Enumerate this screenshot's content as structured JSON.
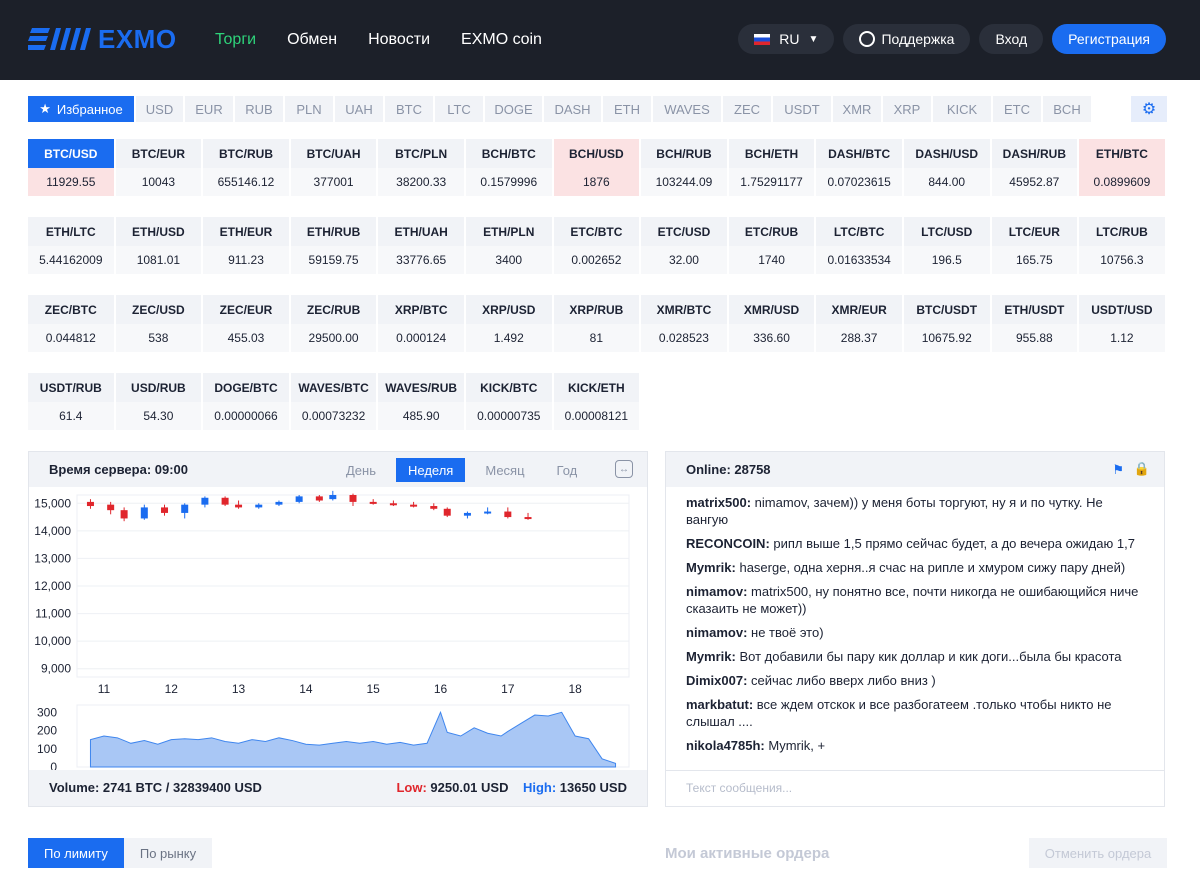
{
  "header": {
    "logo_text": "EXMO",
    "nav": [
      "Торги",
      "Обмен",
      "Новости",
      "EXMO coin"
    ],
    "lang": "RU",
    "support": "Поддержка",
    "login": "Вход",
    "register": "Регистрация"
  },
  "currency_tabs": [
    "Избранное",
    "USD",
    "EUR",
    "RUB",
    "PLN",
    "UAH",
    "BTC",
    "LTC",
    "DOGE",
    "DASH",
    "ETH",
    "WAVES",
    "ZEC",
    "USDT",
    "XMR",
    "XRP",
    "KICK",
    "ETC",
    "BCH"
  ],
  "pair_rows": [
    [
      {
        "pair": "BTC/USD",
        "price": "11929.55"
      },
      {
        "pair": "BTC/EUR",
        "price": "10043"
      },
      {
        "pair": "BTC/RUB",
        "price": "655146.12"
      },
      {
        "pair": "BTC/UAH",
        "price": "377001"
      },
      {
        "pair": "BTC/PLN",
        "price": "38200.33"
      },
      {
        "pair": "BCH/BTC",
        "price": "0.1579996"
      },
      {
        "pair": "BCH/USD",
        "price": "1876"
      },
      {
        "pair": "BCH/RUB",
        "price": "103244.09"
      },
      {
        "pair": "BCH/ETH",
        "price": "1.75291177"
      },
      {
        "pair": "DASH/BTC",
        "price": "0.07023615"
      },
      {
        "pair": "DASH/USD",
        "price": "844.00"
      },
      {
        "pair": "DASH/RUB",
        "price": "45952.87"
      },
      {
        "pair": "ETH/BTC",
        "price": "0.0899609"
      }
    ],
    [
      {
        "pair": "ETH/LTC",
        "price": "5.44162009"
      },
      {
        "pair": "ETH/USD",
        "price": "1081.01"
      },
      {
        "pair": "ETH/EUR",
        "price": "911.23"
      },
      {
        "pair": "ETH/RUB",
        "price": "59159.75"
      },
      {
        "pair": "ETH/UAH",
        "price": "33776.65"
      },
      {
        "pair": "ETH/PLN",
        "price": "3400"
      },
      {
        "pair": "ETC/BTC",
        "price": "0.002652"
      },
      {
        "pair": "ETC/USD",
        "price": "32.00"
      },
      {
        "pair": "ETC/RUB",
        "price": "1740"
      },
      {
        "pair": "LTC/BTC",
        "price": "0.01633534"
      },
      {
        "pair": "LTC/USD",
        "price": "196.5"
      },
      {
        "pair": "LTC/EUR",
        "price": "165.75"
      },
      {
        "pair": "LTC/RUB",
        "price": "10756.3"
      }
    ],
    [
      {
        "pair": "ZEC/BTC",
        "price": "0.044812"
      },
      {
        "pair": "ZEC/USD",
        "price": "538"
      },
      {
        "pair": "ZEC/EUR",
        "price": "455.03"
      },
      {
        "pair": "ZEC/RUB",
        "price": "29500.00"
      },
      {
        "pair": "XRP/BTC",
        "price": "0.000124"
      },
      {
        "pair": "XRP/USD",
        "price": "1.492"
      },
      {
        "pair": "XRP/RUB",
        "price": "81"
      },
      {
        "pair": "XMR/BTC",
        "price": "0.028523"
      },
      {
        "pair": "XMR/USD",
        "price": "336.60"
      },
      {
        "pair": "XMR/EUR",
        "price": "288.37"
      },
      {
        "pair": "BTC/USDT",
        "price": "10675.92"
      },
      {
        "pair": "ETH/USDT",
        "price": "955.88"
      },
      {
        "pair": "USDT/USD",
        "price": "1.12"
      }
    ],
    [
      {
        "pair": "USDT/RUB",
        "price": "61.4"
      },
      {
        "pair": "USD/RUB",
        "price": "54.30"
      },
      {
        "pair": "DOGE/BTC",
        "price": "0.00000066"
      },
      {
        "pair": "WAVES/BTC",
        "price": "0.00073232"
      },
      {
        "pair": "WAVES/RUB",
        "price": "485.90"
      },
      {
        "pair": "KICK/BTC",
        "price": "0.00000735"
      },
      {
        "pair": "KICK/ETH",
        "price": "0.00008121"
      }
    ]
  ],
  "chart": {
    "server_time": "Время сервера: 09:00",
    "periods": [
      "День",
      "Неделя",
      "Месяц",
      "Год"
    ],
    "active_period": "Неделя",
    "volume": "Volume: 2741 BTC / 32839400 USD",
    "low_label": "Low:",
    "low_value": "9250.01 USD",
    "high_label": "High:",
    "high_value": "13650 USD"
  },
  "chart_data": {
    "type": "candlestick",
    "yticks": [
      "15,000",
      "14,000",
      "13,000",
      "12,000",
      "11,000",
      "10,000",
      "9,000"
    ],
    "ylim": [
      8700,
      15300
    ],
    "xticks": [
      "11",
      "12",
      "13",
      "14",
      "15",
      "16",
      "17",
      "18"
    ],
    "x_tick_positions": [
      11,
      12,
      13,
      14,
      15,
      16,
      17,
      18
    ],
    "xlim": [
      10.6,
      18.8
    ],
    "volume_yticks": [
      "300",
      "200",
      "100",
      "0"
    ],
    "volume_ylim": [
      0,
      340
    ],
    "candles": [
      {
        "x": 10.8,
        "o": 15050,
        "c": 14900,
        "h": 15150,
        "l": 14800
      },
      {
        "x": 11.1,
        "o": 14950,
        "c": 14750,
        "h": 15050,
        "l": 14600
      },
      {
        "x": 11.3,
        "o": 14750,
        "c": 14450,
        "h": 14850,
        "l": 14350
      },
      {
        "x": 11.6,
        "o": 14450,
        "c": 14850,
        "h": 14950,
        "l": 14400
      },
      {
        "x": 11.9,
        "o": 14850,
        "c": 14650,
        "h": 14950,
        "l": 14550
      },
      {
        "x": 12.2,
        "o": 14650,
        "c": 14950,
        "h": 15000,
        "l": 14450
      },
      {
        "x": 12.5,
        "o": 14950,
        "c": 15200,
        "h": 15250,
        "l": 14850
      },
      {
        "x": 12.8,
        "o": 15200,
        "c": 14950,
        "h": 15250,
        "l": 14900
      },
      {
        "x": 13.0,
        "o": 14950,
        "c": 14850,
        "h": 15100,
        "l": 14800
      },
      {
        "x": 13.3,
        "o": 14850,
        "c": 14950,
        "h": 15000,
        "l": 14800
      },
      {
        "x": 13.6,
        "o": 14950,
        "c": 15050,
        "h": 15100,
        "l": 14900
      },
      {
        "x": 13.9,
        "o": 15050,
        "c": 15250,
        "h": 15300,
        "l": 15000
      },
      {
        "x": 14.2,
        "o": 15250,
        "c": 15100,
        "h": 15300,
        "l": 15050
      },
      {
        "x": 14.4,
        "o": 15150,
        "c": 15300,
        "h": 15450,
        "l": 15100
      },
      {
        "x": 14.7,
        "o": 15300,
        "c": 15050,
        "h": 15350,
        "l": 14900
      },
      {
        "x": 15.0,
        "o": 15050,
        "c": 15000,
        "h": 15150,
        "l": 14950
      },
      {
        "x": 15.3,
        "o": 15000,
        "c": 14950,
        "h": 15100,
        "l": 14900
      },
      {
        "x": 15.6,
        "o": 14950,
        "c": 14900,
        "h": 15050,
        "l": 14850
      },
      {
        "x": 15.9,
        "o": 14900,
        "c": 14800,
        "h": 15000,
        "l": 14750
      },
      {
        "x": 16.1,
        "o": 14800,
        "c": 14550,
        "h": 14850,
        "l": 14500
      },
      {
        "x": 16.4,
        "o": 14550,
        "c": 14650,
        "h": 14700,
        "l": 14450
      },
      {
        "x": 16.7,
        "o": 14650,
        "c": 14700,
        "h": 14850,
        "l": 14600
      },
      {
        "x": 17.0,
        "o": 14700,
        "c": 14500,
        "h": 14850,
        "l": 14450
      },
      {
        "x": 17.3,
        "o": 14500,
        "c": 14450,
        "h": 14650,
        "l": 14400
      }
    ],
    "volume": [
      [
        10.8,
        150
      ],
      [
        11.0,
        170
      ],
      [
        11.2,
        160
      ],
      [
        11.4,
        130
      ],
      [
        11.6,
        145
      ],
      [
        11.8,
        125
      ],
      [
        12.0,
        150
      ],
      [
        12.2,
        155
      ],
      [
        12.4,
        150
      ],
      [
        12.6,
        160
      ],
      [
        12.8,
        140
      ],
      [
        13.0,
        130
      ],
      [
        13.2,
        150
      ],
      [
        13.4,
        140
      ],
      [
        13.6,
        160
      ],
      [
        13.8,
        145
      ],
      [
        14.0,
        125
      ],
      [
        14.2,
        120
      ],
      [
        14.4,
        130
      ],
      [
        14.6,
        140
      ],
      [
        14.8,
        130
      ],
      [
        15.0,
        140
      ],
      [
        15.2,
        125
      ],
      [
        15.4,
        135
      ],
      [
        15.6,
        120
      ],
      [
        15.8,
        130
      ],
      [
        16.0,
        300
      ],
      [
        16.1,
        190
      ],
      [
        16.3,
        170
      ],
      [
        16.5,
        215
      ],
      [
        16.7,
        185
      ],
      [
        16.9,
        170
      ],
      [
        17.0,
        195
      ],
      [
        17.2,
        240
      ],
      [
        17.4,
        285
      ],
      [
        17.6,
        280
      ],
      [
        17.8,
        300
      ],
      [
        18.0,
        170
      ],
      [
        18.2,
        155
      ],
      [
        18.4,
        45
      ],
      [
        18.6,
        20
      ]
    ]
  },
  "chat": {
    "online": "Online: 28758",
    "messages": [
      {
        "user": "matrix500:",
        "text": " nimamov, зачем)) у меня боты торгуют, ну я и по чутку. Не вангую"
      },
      {
        "user": "RECONCOIN:",
        "text": " рипл выше 1,5 прямо сейчас будет, а до вечера ожидаю 1,7"
      },
      {
        "user": "Mymrik:",
        "text": " haserge, одна херня..я счас на рипле и хмуром сижу пару дней)"
      },
      {
        "user": "nimamov:",
        "text": " matrix500, ну понятно все, почти никогда не ошибающийся ниче сказаить не может))"
      },
      {
        "user": "nimamov:",
        "text": " не твоё это)"
      },
      {
        "user": "Mymrik:",
        "text": " Вот добавили бы пару кик доллар и кик доги...была бы красота"
      },
      {
        "user": "Dimix007:",
        "text": " сейчас либо вверх либо вниз )"
      },
      {
        "user": "markbatut:",
        "text": " все ждем отскок и все разбогатеем .только чтобы никто не слышал ...."
      },
      {
        "user": "nikola4785h:",
        "text": " Mymrik, +"
      }
    ],
    "placeholder": "Текст сообщения..."
  },
  "bottom": {
    "tab_limit": "По лимиту",
    "tab_market": "По рынку",
    "orders_title": "Мои активные ордера",
    "cancel": "Отменить ордера"
  },
  "colors": {
    "accent": "#1a6cf0",
    "up": "#1a6cf0",
    "down": "#e0262c",
    "nav_active": "#2ed37a"
  }
}
